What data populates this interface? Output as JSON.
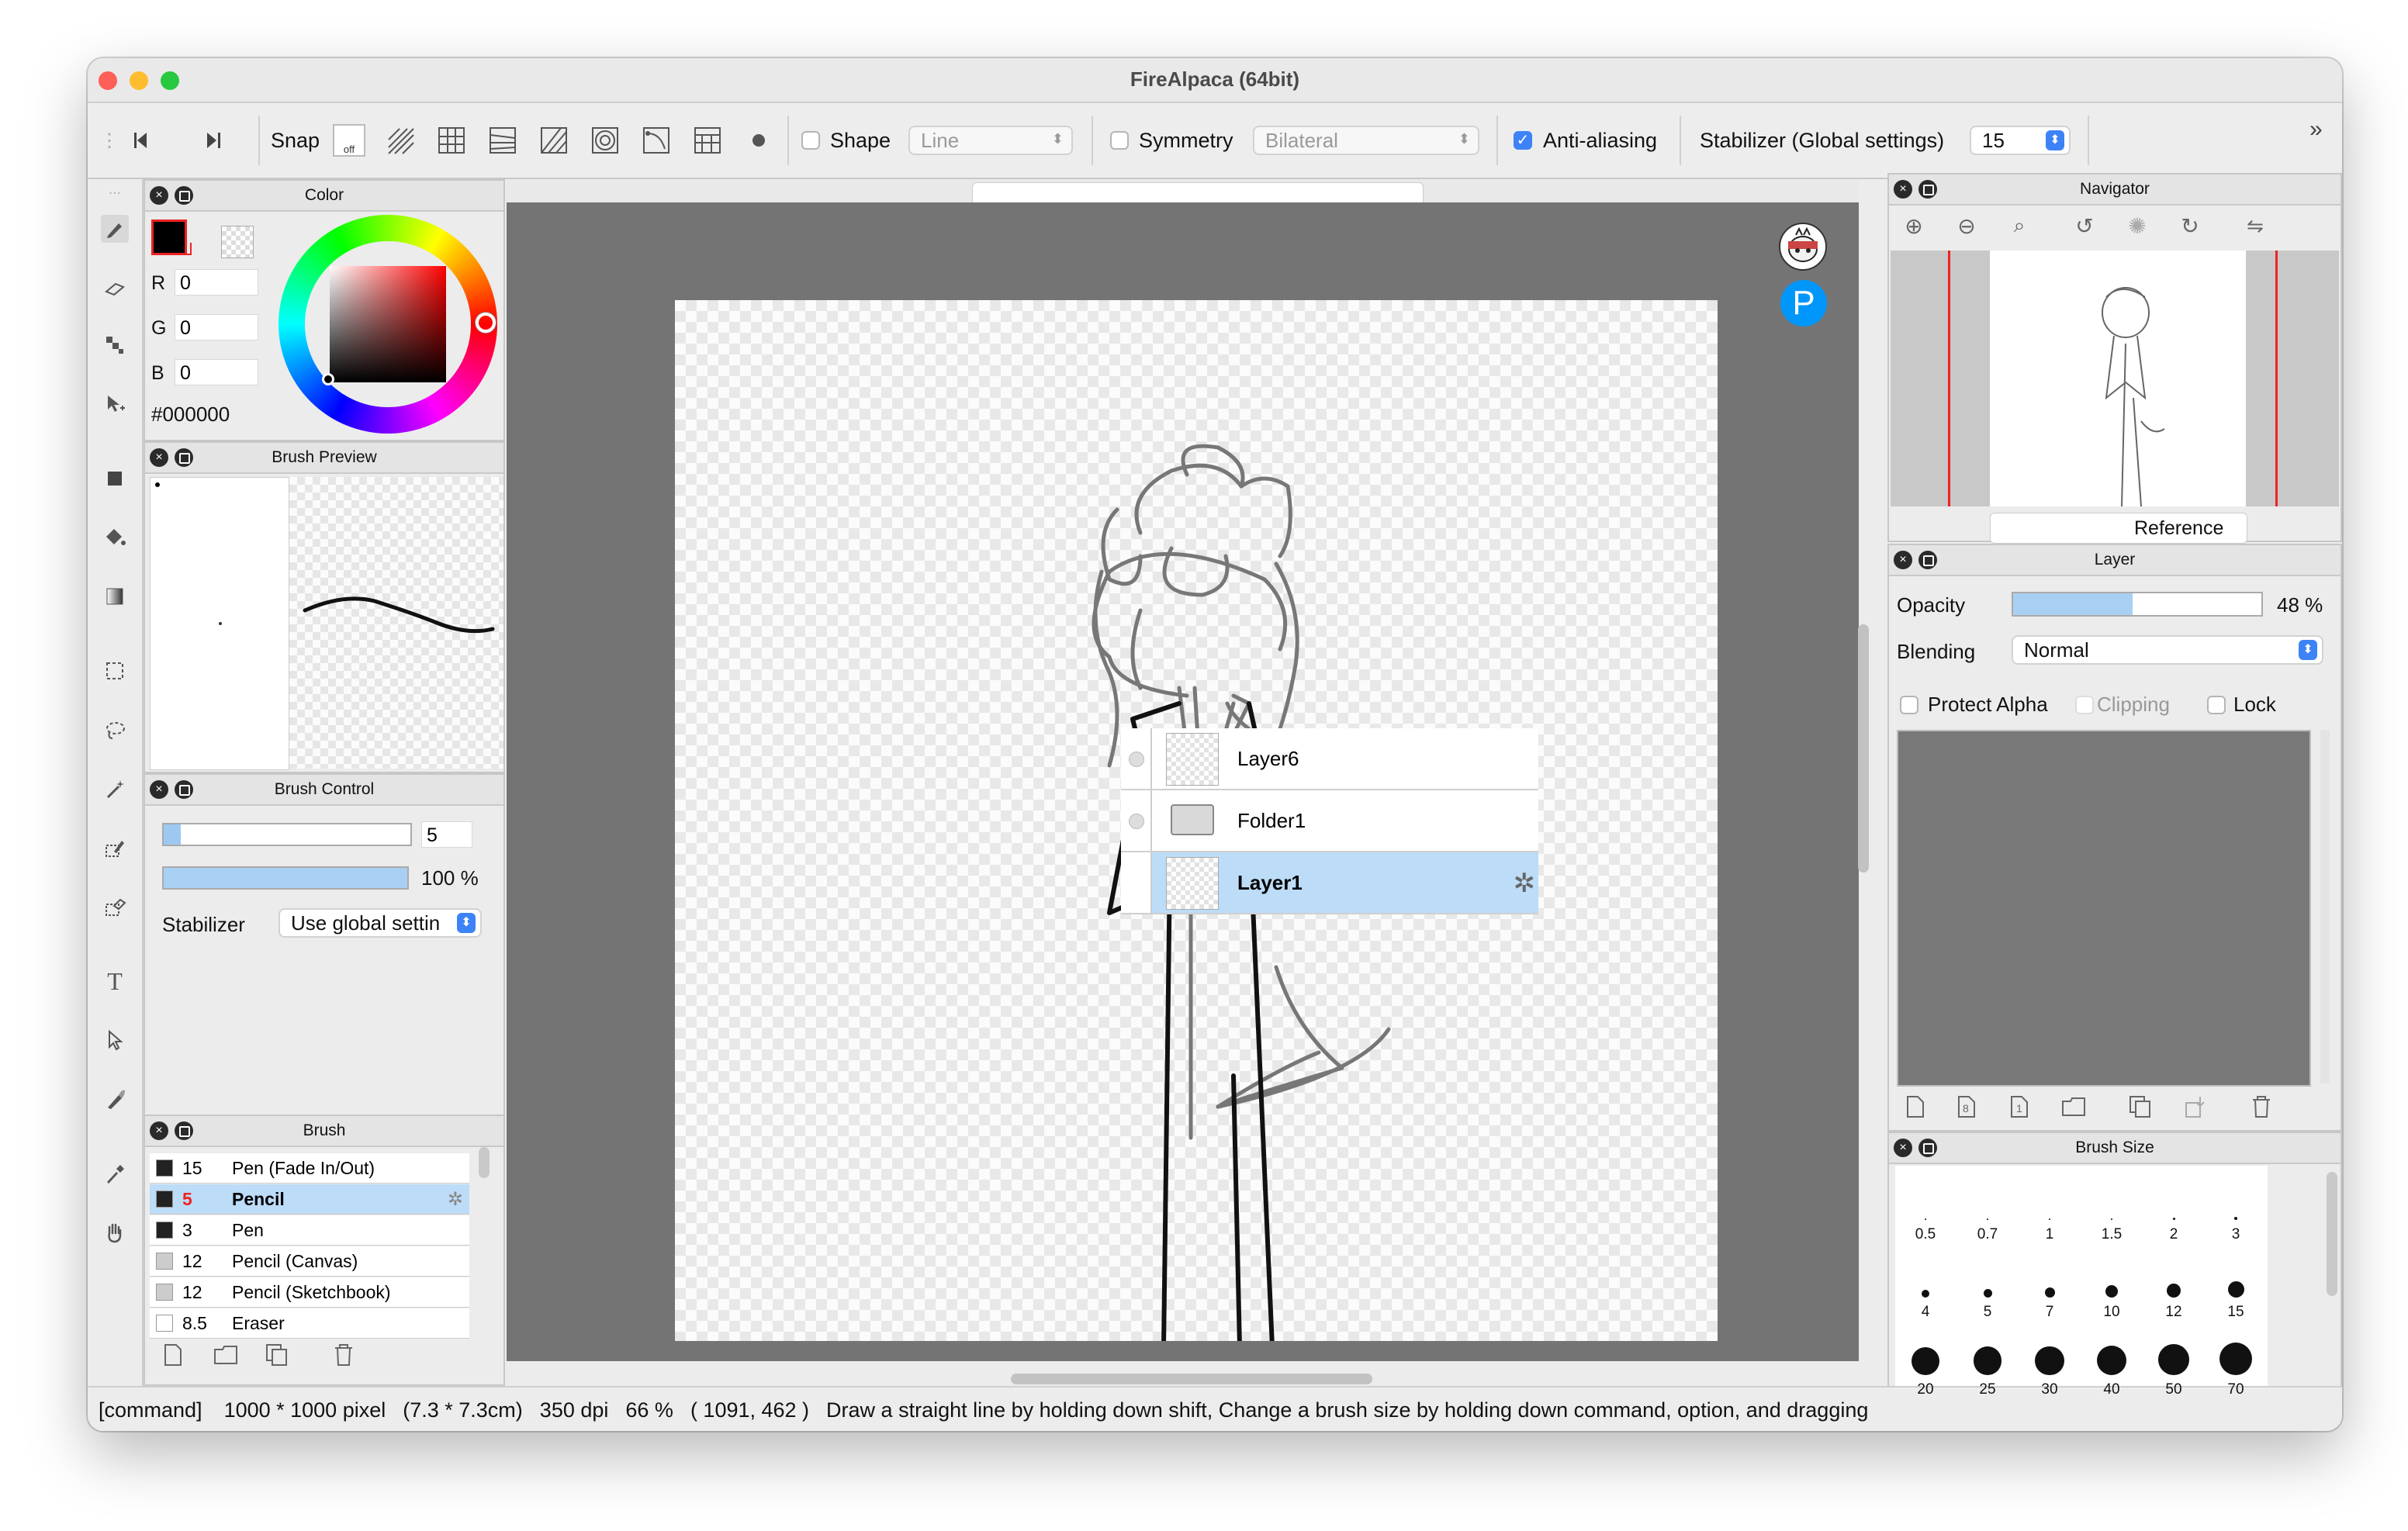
{
  "window": {
    "title": "FireAlpaca (64bit)",
    "traffic_colors": [
      "#fe5f57",
      "#febc2e",
      "#28c840"
    ]
  },
  "toolbar": {
    "snap_label": "Snap",
    "snap_off_label": "off",
    "shape_label": "Shape",
    "shape_value": "Line",
    "symmetry_label": "Symmetry",
    "symmetry_value": "Bilateral",
    "antialias_label": "Anti-aliasing",
    "antialias_checked": true,
    "stabilizer_label": "Stabilizer (Global settings)",
    "stabilizer_value": "15",
    "overflow_icon": "double-chevron-right-icon"
  },
  "color_panel": {
    "title": "Color",
    "r_label": "R",
    "r_value": "0",
    "g_label": "G",
    "g_value": "0",
    "b_label": "B",
    "b_value": "0",
    "hex": "#000000",
    "current_color": "#000000"
  },
  "brush_preview": {
    "title": "Brush Preview"
  },
  "brush_control": {
    "title": "Brush Control",
    "size_value": "5",
    "opacity_value": "100 %",
    "opacity_fraction": 1.0,
    "stabilizer_label": "Stabilizer",
    "stabilizer_value": "Use global settin"
  },
  "brush_panel": {
    "title": "Brush",
    "items": [
      {
        "size": "15",
        "name": "Pen (Fade In/Out)",
        "selected": false,
        "swatch": "#222222"
      },
      {
        "size": "5",
        "name": "Pencil",
        "selected": true,
        "swatch": "#222222"
      },
      {
        "size": "3",
        "name": "Pen",
        "selected": false,
        "swatch": "#222222"
      },
      {
        "size": "12",
        "name": "Pencil (Canvas)",
        "selected": false,
        "swatch": "#cccccc"
      },
      {
        "size": "12",
        "name": "Pencil (Sketchbook)",
        "selected": false,
        "swatch": "#cccccc"
      },
      {
        "size": "8.5",
        "name": "Eraser",
        "selected": false,
        "swatch": "#ffffff"
      }
    ]
  },
  "navigator": {
    "title": "Navigator",
    "reference_label": "Reference"
  },
  "layer_panel": {
    "title": "Layer",
    "opacity_label": "Opacity",
    "opacity_value": "48 %",
    "opacity_fraction": 0.48,
    "blending_label": "Blending",
    "blending_value": "Normal",
    "protect_alpha_label": "Protect Alpha",
    "clipping_label": "Clipping",
    "lock_label": "Lock",
    "layers": [
      {
        "name": "Layer6",
        "type": "layer",
        "selected": false
      },
      {
        "name": "Folder1",
        "type": "folder",
        "selected": false
      },
      {
        "name": "Layer1",
        "type": "layer",
        "selected": true
      }
    ]
  },
  "brush_size_panel": {
    "title": "Brush Size",
    "sizes": [
      "0.5",
      "0.7",
      "1",
      "1.5",
      "2",
      "3",
      "4",
      "5",
      "7",
      "10",
      "12",
      "15",
      "20",
      "25",
      "30",
      "40",
      "50",
      "70"
    ]
  },
  "status": {
    "mode": "[command]",
    "dimensions": "1000 * 1000 pixel",
    "physical": "(7.3 * 7.3cm)",
    "dpi": "350 dpi",
    "zoom": "66 %",
    "coords": "( 1091, 462 )",
    "hint": "Draw a straight line by holding down shift, Change a brush size by holding down command, option, and dragging"
  }
}
